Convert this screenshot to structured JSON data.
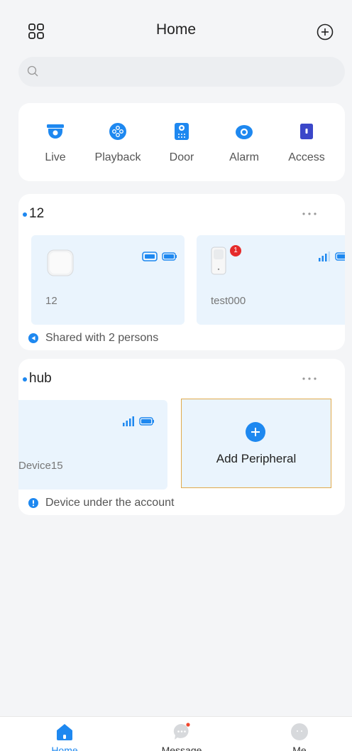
{
  "header": {
    "title": "Home",
    "left_icon": "grid-icon",
    "right_icon": "add-circle-icon"
  },
  "search": {
    "placeholder": "",
    "icon": "search-icon"
  },
  "quick_menu": [
    {
      "label": "Live",
      "icon": "camera-icon"
    },
    {
      "label": "Playback",
      "icon": "playback-icon"
    },
    {
      "label": "Door",
      "icon": "doorbell-icon"
    },
    {
      "label": "Alarm",
      "icon": "alarm-icon"
    },
    {
      "label": "Access",
      "icon": "access-icon"
    }
  ],
  "groups": [
    {
      "name": "12",
      "devices": [
        {
          "name": "12",
          "icon": "hub-device-icon",
          "status": [
            "camera-status-icon",
            "battery-icon"
          ]
        },
        {
          "name": "test000",
          "icon": "motion-sensor-icon",
          "badge": "1",
          "status": [
            "signal-icon",
            "battery-icon"
          ]
        }
      ],
      "footer": "Shared with 2 persons",
      "footer_icon": "share-icon"
    },
    {
      "name": "hub",
      "devices": [
        {
          "name": "Device15",
          "status": [
            "signal-icon",
            "battery-icon"
          ]
        }
      ],
      "add_label": "Add Peripheral",
      "footer": "Device under the account",
      "footer_icon": "account-icon"
    }
  ],
  "tabs": [
    {
      "label": "Home",
      "icon": "home-icon",
      "active": true
    },
    {
      "label": "Message",
      "icon": "message-icon",
      "active": false
    },
    {
      "label": "Me",
      "icon": "profile-icon",
      "active": false
    }
  ],
  "colors": {
    "accent": "#1e88f0",
    "tile_bg": "#eaf4fd",
    "badge": "#e52b2b",
    "highlight_border": "#e0a94a"
  }
}
